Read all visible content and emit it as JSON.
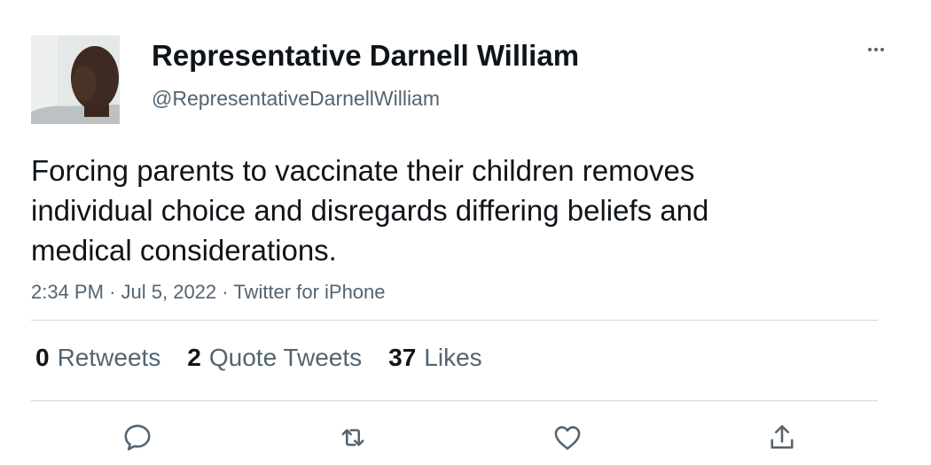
{
  "author": {
    "display_name": "Representative Darnell William",
    "handle": "@RepresentativeDarnellWilliam"
  },
  "tweet": {
    "lines": [
      "Forcing parents to vaccinate their children removes",
      "individual choice and disregards differing beliefs and",
      "medical considerations."
    ],
    "time": "2:34 PM",
    "date": "Jul 5, 2022",
    "source": "Twitter for iPhone",
    "separator": "·"
  },
  "stats": {
    "retweets": {
      "count": "0",
      "label": "Retweets"
    },
    "quote_tweets": {
      "count": "2",
      "label": "Quote Tweets"
    },
    "likes": {
      "count": "37",
      "label": "Likes"
    }
  },
  "icons": {
    "more": "more-horizontal-icon",
    "reply": "reply-icon",
    "retweet": "retweet-icon",
    "like": "heart-icon",
    "share": "share-icon"
  },
  "colors": {
    "text": "#0f1419",
    "secondary": "#536471",
    "divider": "#cfd9de"
  }
}
